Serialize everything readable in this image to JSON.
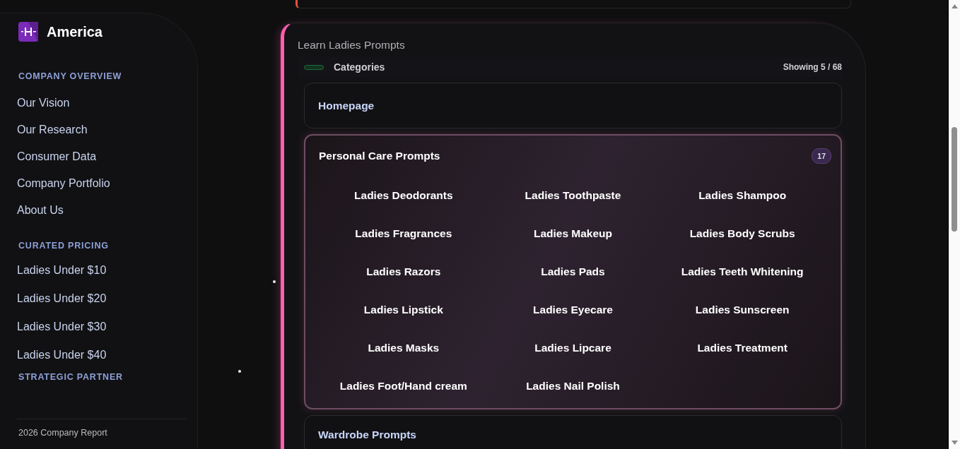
{
  "brand": {
    "name": "America"
  },
  "sidebar": {
    "sections": [
      {
        "heading": "COMPANY OVERVIEW",
        "items": [
          "Our Vision",
          "Our Research",
          "Consumer Data",
          "Company Portfolio",
          "About Us"
        ]
      },
      {
        "heading": "CURATED PRICING",
        "items": [
          "Ladies Under $10",
          "Ladies Under $20",
          "Ladies Under $30",
          "Ladies Under $40"
        ]
      },
      {
        "heading": "STRATEGIC PARTNER"
      }
    ],
    "footer": "2026 Company Report"
  },
  "panel": {
    "title": "Learn Ladies Prompts",
    "header_label": "Categories",
    "showing": "Showing 5 / 68",
    "categories": [
      {
        "name": "Homepage",
        "expanded": false
      },
      {
        "name": "Personal Care Prompts",
        "expanded": true,
        "count": "17",
        "items": [
          "Ladies Deodorants",
          "Ladies Toothpaste",
          "Ladies Shampoo",
          "Ladies Fragrances",
          "Ladies Makeup",
          "Ladies Body Scrubs",
          "Ladies Razors",
          "Ladies Pads",
          "Ladies Teeth Whitening",
          "Ladies Lipstick",
          "Ladies Eyecare",
          "Ladies Sunscreen",
          "Ladies Masks",
          "Ladies Lipcare",
          "Ladies Treatment",
          "Ladies Foot/Hand cream",
          "Ladies Nail Polish"
        ]
      },
      {
        "name": "Wardrobe Prompts",
        "expanded": false
      }
    ]
  }
}
